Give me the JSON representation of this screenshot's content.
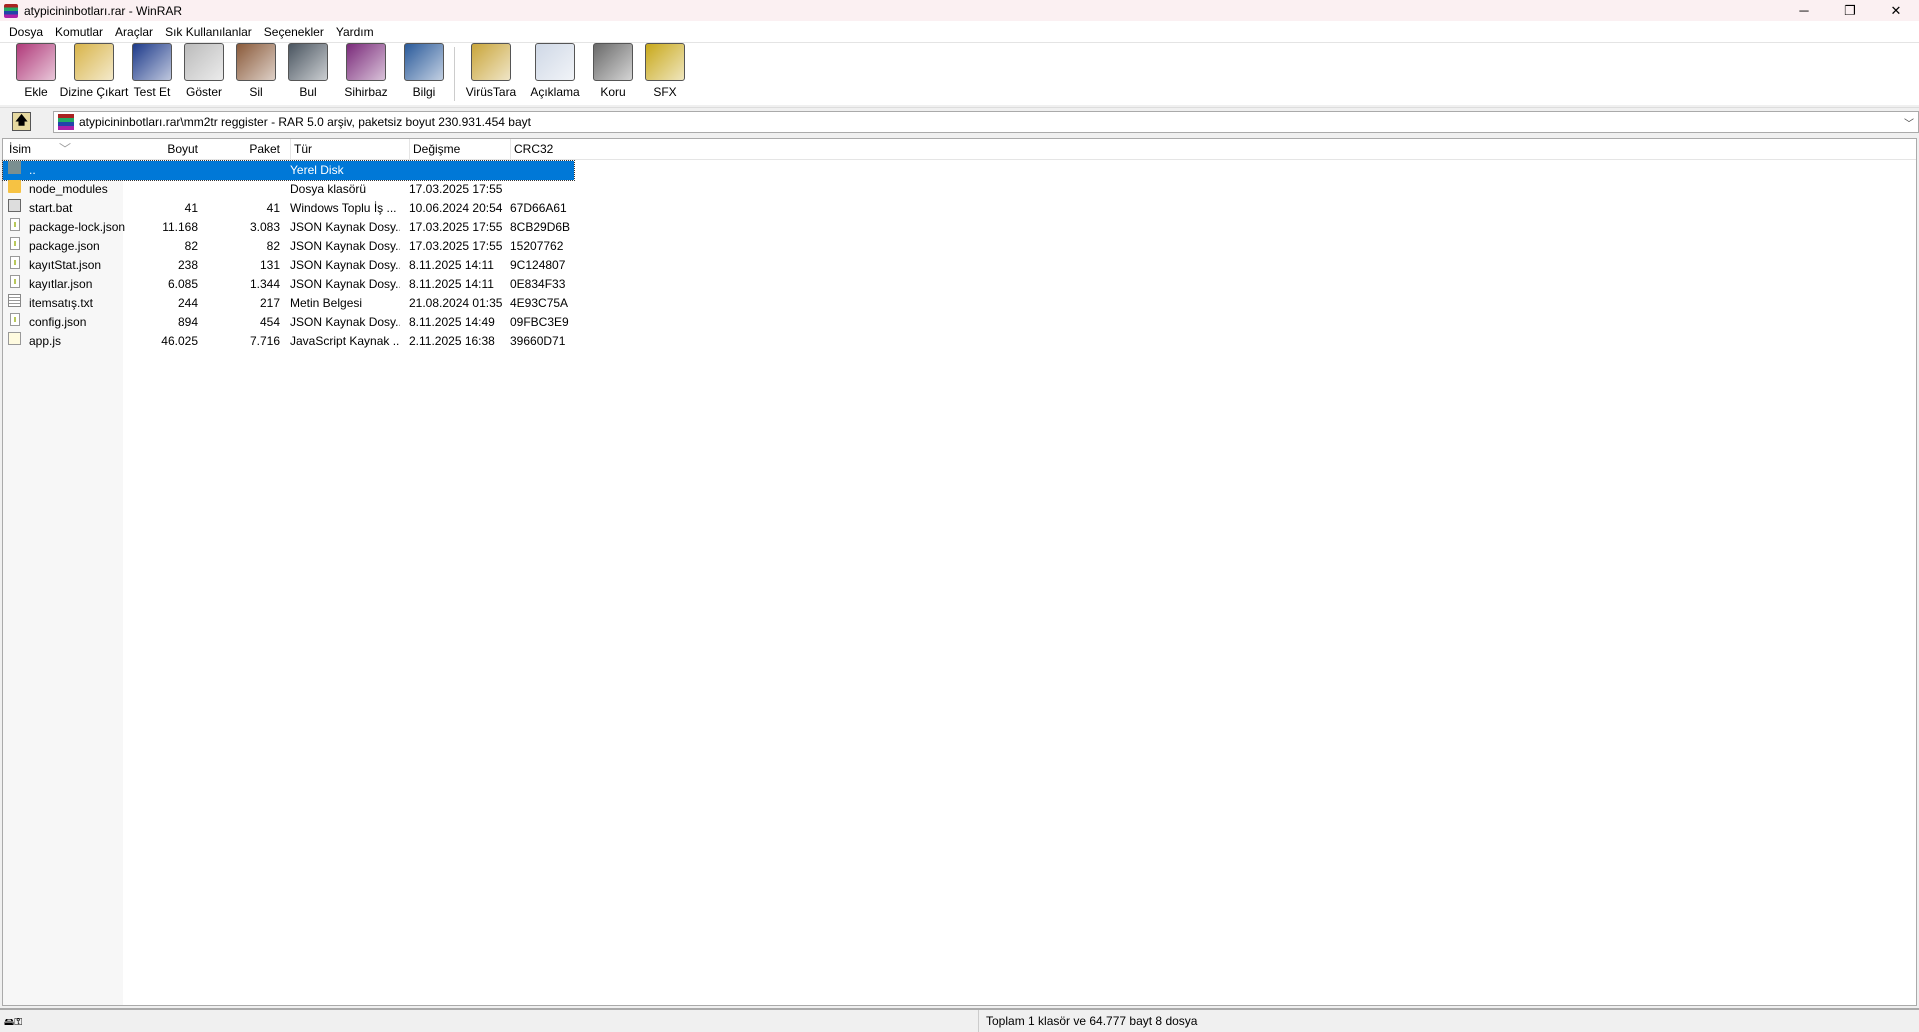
{
  "window": {
    "title": "atypicininbotları.rar - WinRAR",
    "controls": [
      "─",
      "❐",
      "✕"
    ]
  },
  "menu": [
    "Dosya",
    "Komutlar",
    "Araçlar",
    "Sık Kullanılanlar",
    "Seçenekler",
    "Yardım"
  ],
  "toolbar": [
    {
      "label": "Ekle",
      "icon": "add-archive-icon",
      "color": "#b03a7a"
    },
    {
      "label": "Dizine Çıkart",
      "icon": "extract-icon",
      "color": "#d8b44a"
    },
    {
      "label": "Test Et",
      "icon": "test-icon",
      "color": "#1d3a8a"
    },
    {
      "label": "Göster",
      "icon": "view-icon",
      "color": "#bbbbbb"
    },
    {
      "label": "Sil",
      "icon": "delete-icon",
      "color": "#8a5a3a"
    },
    {
      "label": "Bul",
      "icon": "find-icon",
      "color": "#4a5560"
    },
    {
      "label": "Sihirbaz",
      "icon": "wizard-icon",
      "color": "#7a2a7a"
    },
    {
      "label": "Bilgi",
      "icon": "info-icon",
      "color": "#2a5a9a"
    },
    {
      "label": "VirüsTara",
      "icon": "virus-scan-icon",
      "color": "#c9a53a"
    },
    {
      "label": "Açıklama",
      "icon": "comment-icon",
      "color": "#cfd8e6"
    },
    {
      "label": "Koru",
      "icon": "protect-icon",
      "color": "#6a6a6a"
    },
    {
      "label": "SFX",
      "icon": "sfx-icon",
      "color": "#c8a81a"
    }
  ],
  "address": {
    "up_label": "🡅",
    "path": "atypicininbotları.rar\\mm2tr reggister - RAR 5.0 arşiv, paketsiz boyut 230.931.454 bayt",
    "dropdown": "﹀"
  },
  "columns": [
    "İsim",
    "Boyut",
    "Paket",
    "Tür",
    "Değişme",
    "CRC32"
  ],
  "sort_indicator": "﹀",
  "files": [
    {
      "name": "..",
      "size": "",
      "packed": "",
      "type": "Yerel Disk",
      "modified": "",
      "crc": "",
      "icon": "updir"
    },
    {
      "name": "node_modules",
      "size": "",
      "packed": "",
      "type": "Dosya klasörü",
      "modified": "17.03.2025 17:55",
      "crc": "",
      "icon": "folder"
    },
    {
      "name": "start.bat",
      "size": "41",
      "packed": "41",
      "type": "Windows Toplu İş ...",
      "modified": "10.06.2024 20:54",
      "crc": "67D66A61",
      "icon": "bat"
    },
    {
      "name": "package-lock.json",
      "size": "11.168",
      "packed": "3.083",
      "type": "JSON Kaynak Dosy...",
      "modified": "17.03.2025 17:55",
      "crc": "8CB29D6B",
      "icon": "file"
    },
    {
      "name": "package.json",
      "size": "82",
      "packed": "82",
      "type": "JSON Kaynak Dosy...",
      "modified": "17.03.2025 17:55",
      "crc": "15207762",
      "icon": "file"
    },
    {
      "name": "kayıtStat.json",
      "size": "238",
      "packed": "131",
      "type": "JSON Kaynak Dosy...",
      "modified": "8.11.2025 14:11",
      "crc": "9C124807",
      "icon": "file"
    },
    {
      "name": "kayıtlar.json",
      "size": "6.085",
      "packed": "1.344",
      "type": "JSON Kaynak Dosy...",
      "modified": "8.11.2025 14:11",
      "crc": "0E834F33",
      "icon": "file"
    },
    {
      "name": "itemsatış.txt",
      "size": "244",
      "packed": "217",
      "type": "Metin Belgesi",
      "modified": "21.08.2024 01:35",
      "crc": "4E93C75A",
      "icon": "txt"
    },
    {
      "name": "config.json",
      "size": "894",
      "packed": "454",
      "type": "JSON Kaynak Dosy...",
      "modified": "8.11.2025 14:49",
      "crc": "09FBC3E9",
      "icon": "file"
    },
    {
      "name": "app.js",
      "size": "46.025",
      "packed": "7.716",
      "type": "JavaScript Kaynak ...",
      "modified": "2.11.2025 16:38",
      "crc": "39660D71",
      "icon": "js"
    }
  ],
  "status": {
    "left_icons": "🖴⚿",
    "text": "Toplam 1 klasör ve 64.777 bayt 8 dosya"
  }
}
